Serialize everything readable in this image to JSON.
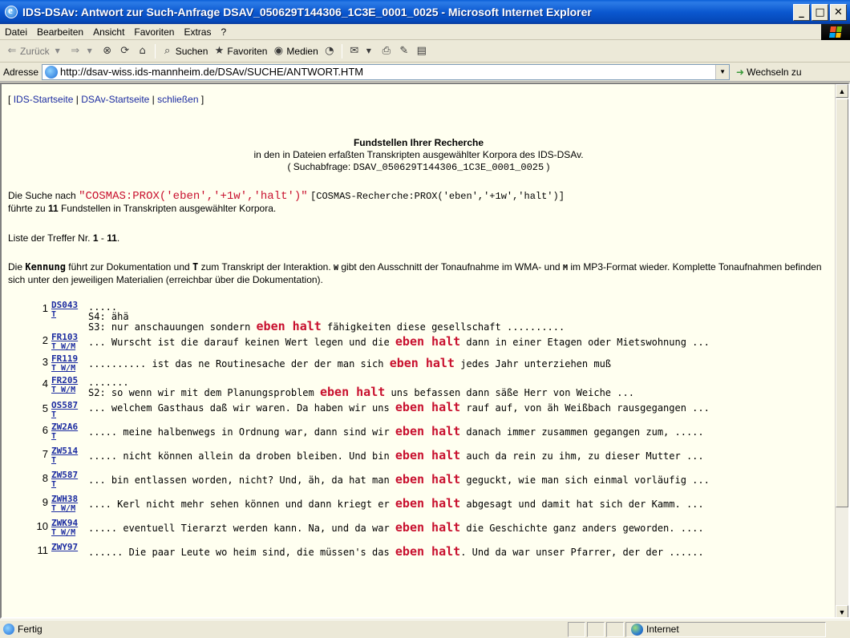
{
  "window": {
    "title": "IDS-DSAv: Antwort zur Such-Anfrage DSAV_050629T144306_1C3E_0001_0025 - Microsoft Internet Explorer",
    "buttons": {
      "minimize": "_",
      "maximize": "□",
      "close": "✕"
    }
  },
  "menu": {
    "items": [
      "Datei",
      "Bearbeiten",
      "Ansicht",
      "Favoriten",
      "Extras",
      "?"
    ]
  },
  "toolbar": {
    "back": "Zurück",
    "search": "Suchen",
    "favorites": "Favoriten",
    "media": "Medien"
  },
  "address": {
    "label": "Adresse",
    "url": "http://dsav-wiss.ids-mannheim.de/DSAv/SUCHE/ANTWORT.HTM",
    "go": "Wechseln zu"
  },
  "nav": {
    "open": "[",
    "link1": "IDS-Startseite",
    "sep1": " | ",
    "link2": "DSAv-Startseite",
    "sep2": " | ",
    "link3": "schließen",
    "close": " ]"
  },
  "heading": {
    "title": "Fundstellen Ihrer Recherche",
    "subtitle": "in den in Dateien erfaßten Transkripten ausgewählter Korpora des IDS-DSAv.",
    "query_prefix": "( Suchabfrage:",
    "query_id": "DSAV_050629T144306_1C3E_0001_0025",
    "query_suffix": " )"
  },
  "search": {
    "prefix": "Die Suche nach ",
    "query": "\"COSMAS:PROX('eben','+1w','halt')\"",
    "bracket": "[COSMAS-Recherche:PROX('eben','+1w','halt')]",
    "result_prefix": "führte zu ",
    "count": "11",
    "result_suffix": " Fundstellen in Transkripten ausgewählter Korpora."
  },
  "list": {
    "prefix": "Liste der Treffer Nr. ",
    "from": "1",
    "dash": " - ",
    "to": "11",
    "suffix": "."
  },
  "description": {
    "p1": "Die ",
    "kennung": "Kennung",
    "p2": " führt zur Dokumentation und ",
    "t": "T",
    "p3": " zum Transkript der Interaktion. ",
    "w": "W",
    "p4": " gibt den Ausschnitt der Tonaufnahme im WMA- und ",
    "m": "M",
    "p5": " im MP3-Format wieder. Komplette Tonaufnahmen befinden sich unter den jeweiligen Materialien (erreichbar über die Dokumentation)."
  },
  "hits": [
    {
      "num": "1",
      "id": "DS043",
      "links": "T",
      "lines": [
        ".....",
        "S4: ähä"
      ],
      "pre": "S3: nur anschauungen sondern ",
      "hl": "eben halt",
      "post": " fähigkeiten diese gesellschaft .........."
    },
    {
      "num": "2",
      "id": "FR103",
      "links": "T W/M",
      "lines": [],
      "pre": "... Wurscht ist die darauf keinen Wert legen und die ",
      "hl": "eben halt",
      "post": " dann in einer Etagen oder Mietswohnung ..."
    },
    {
      "num": "3",
      "id": "FR119",
      "links": "T W/M",
      "lines": [],
      "pre": ".......... ist das ne Routinesache der der man sich ",
      "hl": "eben halt",
      "post": " jedes Jahr unterziehen muß"
    },
    {
      "num": "4",
      "id": "FR205",
      "links": "T W/M",
      "lines": [
        "......."
      ],
      "pre": "S2: so wenn wir mit dem Planungsproblem ",
      "hl": "eben halt",
      "post": " uns befassen dann säße Herr von Weiche ..."
    },
    {
      "num": "5",
      "id": "OS587",
      "links": "T",
      "lines": [],
      "pre": "... welchem Gasthaus daß wir waren. Da haben wir uns ",
      "hl": "eben halt",
      "post": " rauf auf, von äh Weißbach rausgegangen ..."
    },
    {
      "num": "6",
      "id": "ZW2A6",
      "links": "T",
      "lines": [],
      "pre": "..... meine halbenwegs in Ordnung war, dann sind wir ",
      "hl": "eben halt",
      "post": " danach immer zusammen gegangen zum, ....."
    },
    {
      "num": "7",
      "id": "ZW514",
      "links": "T",
      "lines": [],
      "pre": "..... nicht können allein da droben bleiben. Und bin ",
      "hl": "eben halt",
      "post": " auch da rein zu ihm, zu dieser Mutter ..."
    },
    {
      "num": "8",
      "id": "ZW587",
      "links": "T",
      "lines": [],
      "pre": "... bin entlassen worden, nicht? Und, äh, da hat man ",
      "hl": "eben halt",
      "post": " geguckt, wie man sich einmal vorläufig ..."
    },
    {
      "num": "9",
      "id": "ZWH38",
      "links": "T W/M",
      "lines": [],
      "pre": ".... Kerl nicht mehr sehen können und dann kriegt er ",
      "hl": "eben halt",
      "post": " abgesagt und damit hat sich der Kamm. ..."
    },
    {
      "num": "10",
      "id": "ZWK94",
      "links": "T W/M",
      "lines": [],
      "pre": "..... eventuell Tierarzt werden kann. Na, und da war ",
      "hl": "eben halt",
      "post": " die Geschichte ganz anders geworden. ...."
    },
    {
      "num": "11",
      "id": "ZWY97",
      "links": "",
      "lines": [],
      "pre": "...... Die paar Leute wo heim sind, die müssen's das ",
      "hl": "eben halt",
      "post": ". Und da war unser Pfarrer, der der ......"
    }
  ],
  "status": {
    "text": "Fertig",
    "zone": "Internet"
  }
}
